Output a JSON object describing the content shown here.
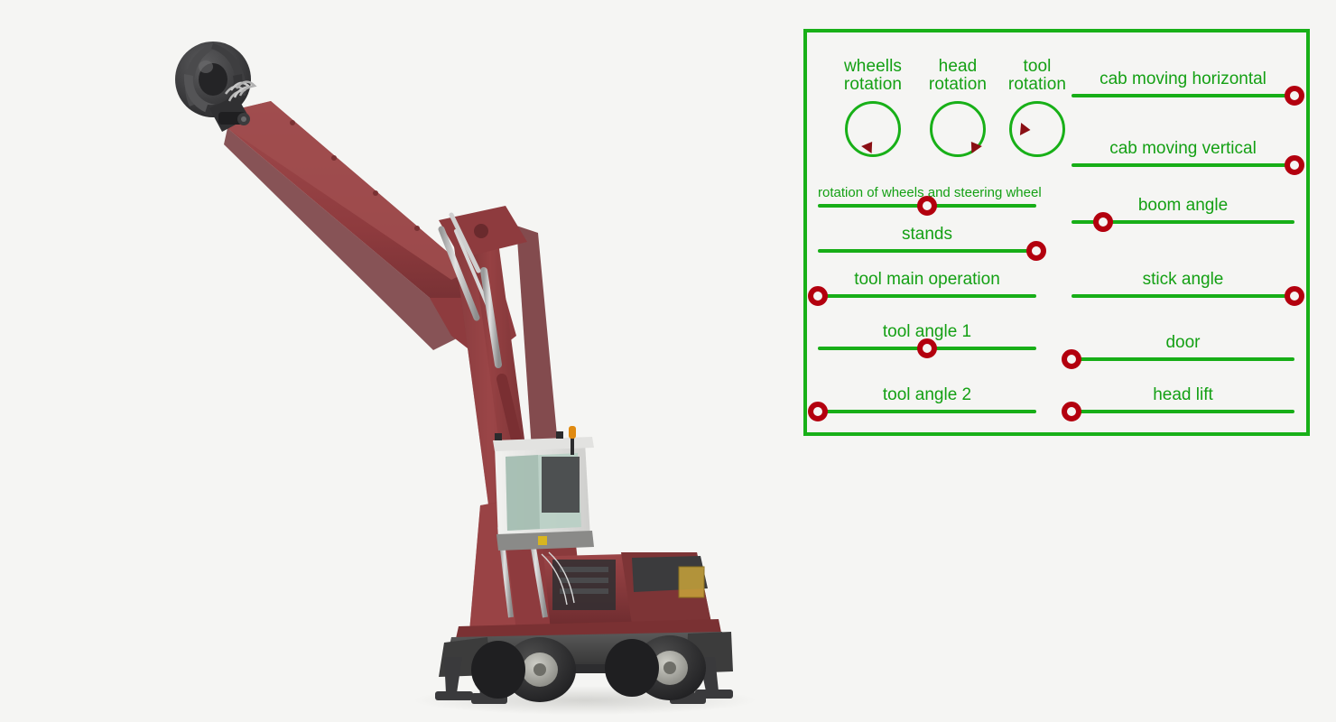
{
  "background_color": "#f5f5f3",
  "panel": {
    "border_color": "#18b018",
    "text_color": "#14a014",
    "track_color": "#17ae17",
    "handle_color": "#b3000e",
    "pointer_color": "#8a0f14",
    "dials": [
      {
        "name": "wheells-rotation",
        "label": "wheells\nrotation",
        "angle_deg": 215
      },
      {
        "name": "head-rotation",
        "label": "head\nrotation",
        "angle_deg": 145
      },
      {
        "name": "tool-rotation",
        "label": "tool\nrotation",
        "angle_deg": 275
      }
    ],
    "sliders_left": [
      {
        "name": "rotation-of-wheels-and-steering-wheel",
        "label": "rotation of wheels and steering wheel",
        "small": true,
        "value": 0.5
      },
      {
        "name": "stands",
        "label": "stands",
        "small": false,
        "value": 1.0
      },
      {
        "name": "tool-main-operation",
        "label": "tool main operation",
        "small": false,
        "value": 0.0
      },
      {
        "name": "tool-angle-1",
        "label": "tool angle 1",
        "small": false,
        "value": 0.5
      },
      {
        "name": "tool-angle-2",
        "label": "tool angle 2",
        "small": false,
        "value": 0.0
      }
    ],
    "sliders_right": [
      {
        "name": "cab-moving-horizontal",
        "label": "cab moving horizontal",
        "value": 1.0
      },
      {
        "name": "cab-moving-vertical",
        "label": "cab moving vertical",
        "value": 1.0
      },
      {
        "name": "boom-angle",
        "label": "boom angle",
        "value": 0.14
      },
      {
        "name": "stick-angle",
        "label": "stick angle",
        "value": 1.0
      },
      {
        "name": "door",
        "label": "door",
        "value": 0.0
      },
      {
        "name": "head-lift",
        "label": "head lift",
        "value": 0.0
      }
    ]
  },
  "machine": {
    "name": "material-handler-excavator",
    "body_color": "#8e3b3e",
    "body_dark": "#6e2d30",
    "body_light": "#a04a4c",
    "undercarriage_color": "#4a4a4a",
    "undercarriage_dark": "#333333",
    "cab_color": "#e8e8e6",
    "glass_color": "#b9cfc4",
    "grapple_color": "#3a3a3c",
    "cylinder_color": "#c9c9c9",
    "beacon_color": "#e08a10"
  }
}
